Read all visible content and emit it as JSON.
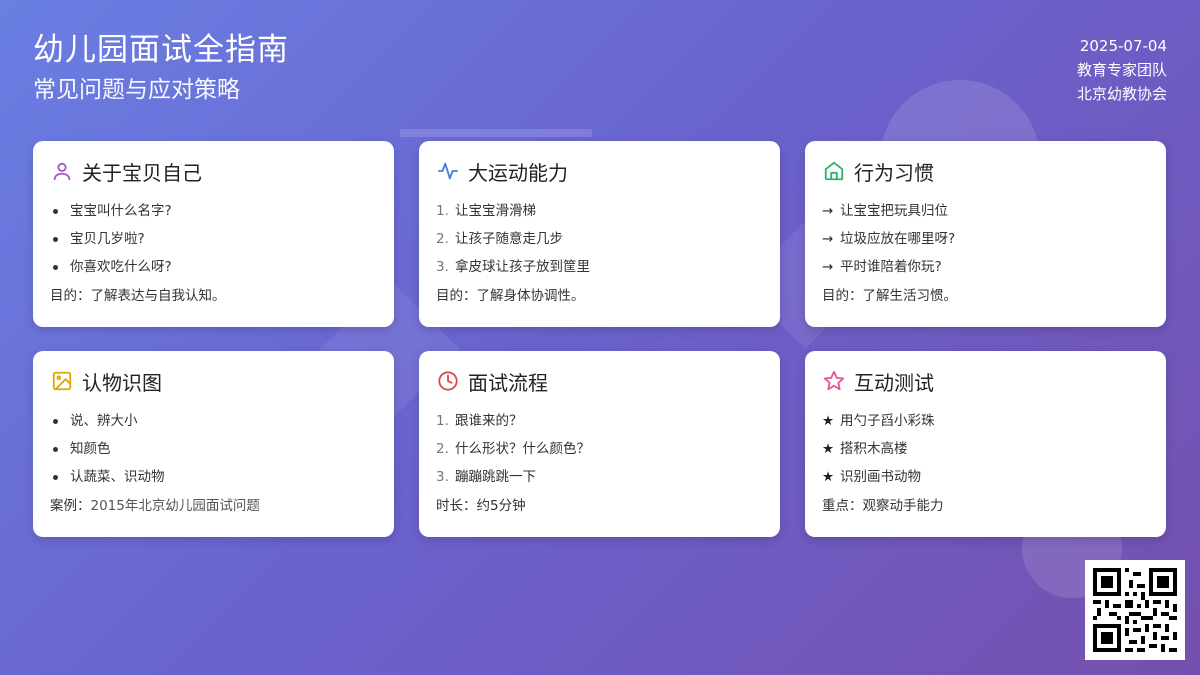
{
  "header": {
    "title": "幼儿园面试全指南",
    "subtitle": "常见问题与应对策略",
    "date": "2025-07-04",
    "team": "教育专家团队",
    "org": "北京幼教协会"
  },
  "cards": [
    {
      "icon": "user-icon",
      "icon_color": "#a855c7",
      "title": "关于宝贝自己",
      "bullet_style": "dot",
      "items": [
        "宝宝叫什么名字?",
        "宝贝几岁啦?",
        "你喜欢吃什么呀?"
      ],
      "foot": "目的：了解表达与自我认知。"
    },
    {
      "icon": "activity-icon",
      "icon_color": "#4a7fd4",
      "title": "大运动能力",
      "bullet_style": "number",
      "bullets": [
        "1.",
        "2.",
        "3."
      ],
      "items": [
        "让宝宝滑滑梯",
        "让孩子随意走几步",
        "拿皮球让孩子放到筐里"
      ],
      "foot": "目的：了解身体协调性。"
    },
    {
      "icon": "home-icon",
      "icon_color": "#2fb36a",
      "title": "行为习惯",
      "bullet_style": "arrow",
      "bullets": [
        "→",
        "→",
        "→"
      ],
      "items": [
        "让宝宝把玩具归位",
        "垃圾应放在哪里呀?",
        "平时谁陪着你玩?"
      ],
      "foot": "目的：了解生活习惯。"
    },
    {
      "icon": "image-icon",
      "icon_color": "#e0a800",
      "title": "认物识图",
      "bullet_style": "dot",
      "items": [
        "说、辨大小",
        "知颜色",
        "认蔬菜、识动物"
      ],
      "foot_label": "案例：",
      "foot_value": "2015年北京幼儿园面试问题"
    },
    {
      "icon": "clock-icon",
      "icon_color": "#d94b4b",
      "title": "面试流程",
      "bullet_style": "number",
      "bullets": [
        "1.",
        "2.",
        "3."
      ],
      "items": [
        "跟谁来的？",
        "什么形状？什么颜色？",
        "蹦蹦跳跳一下"
      ],
      "foot": "时长：约5分钟"
    },
    {
      "icon": "star-icon",
      "icon_color": "#e0559b",
      "title": "互动测试",
      "bullet_style": "star",
      "bullets": [
        "★",
        "★",
        "★"
      ],
      "items": [
        "用勺子舀小彩珠",
        "搭积木高楼",
        "识别画书动物"
      ],
      "foot": "重点：观察动手能力"
    }
  ],
  "qr": {
    "icon": "qr-code-icon"
  }
}
